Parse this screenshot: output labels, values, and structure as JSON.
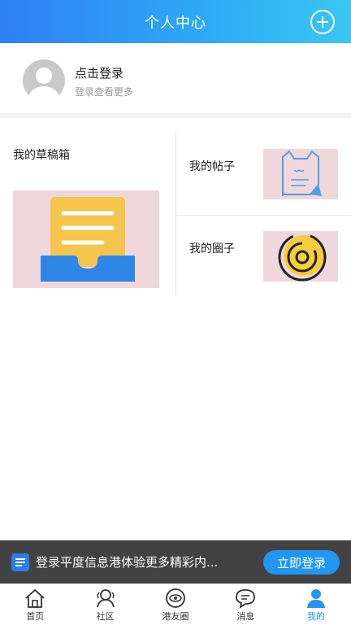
{
  "header": {
    "title": "个人中心"
  },
  "profile": {
    "login_title": "点击登录",
    "login_subtitle": "登录查看更多"
  },
  "grid": {
    "drafts_label": "我的草稿箱",
    "posts_label": "我的帖子",
    "circles_label": "我的圈子"
  },
  "banner": {
    "text": "登录平度信息港体验更多精彩内...",
    "button": "立即登录"
  },
  "tabs": [
    {
      "label": "首页",
      "icon": "home-icon"
    },
    {
      "label": "社区",
      "icon": "community-icon"
    },
    {
      "label": "港友圈",
      "icon": "friends-circle-icon"
    },
    {
      "label": "消息",
      "icon": "message-icon"
    },
    {
      "label": "我的",
      "icon": "profile-icon",
      "active": true
    }
  ],
  "colors": {
    "accent": "#2196f3",
    "card_bg": "#f0d7dc",
    "header_start": "#2f7ff5",
    "header_end": "#3ac6f3"
  }
}
